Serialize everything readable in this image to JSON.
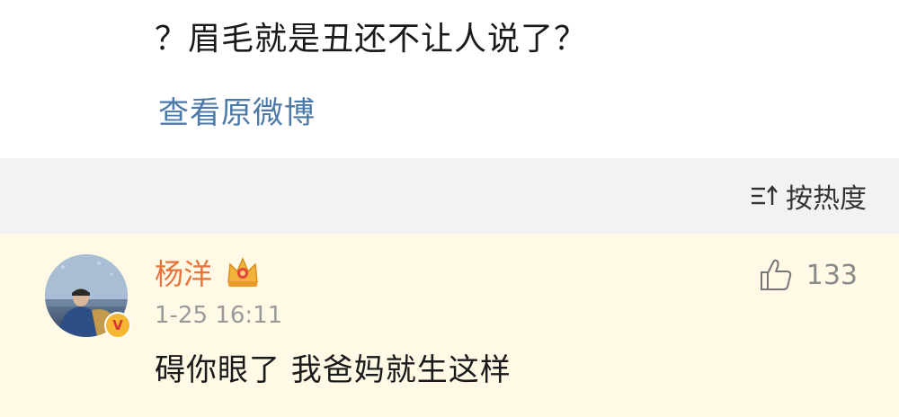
{
  "post": {
    "text": "？眉毛就是丑还不让人说了？",
    "view_original": "查看原微博"
  },
  "sort": {
    "label": "按热度",
    "icon": "sort-icon"
  },
  "comment": {
    "username": "杨洋",
    "badge_icon": "crown-icon",
    "verified_mark": "V",
    "time": "1-25 16:11",
    "text": "碍你眼了 我爸妈就生这样",
    "like_icon": "thumbs-up-icon",
    "like_count": "133"
  },
  "colors": {
    "link": "#4b79a8",
    "username": "#e8733a",
    "comment_bg": "#fff9e6",
    "sort_bar_bg": "#f2f2f2"
  }
}
